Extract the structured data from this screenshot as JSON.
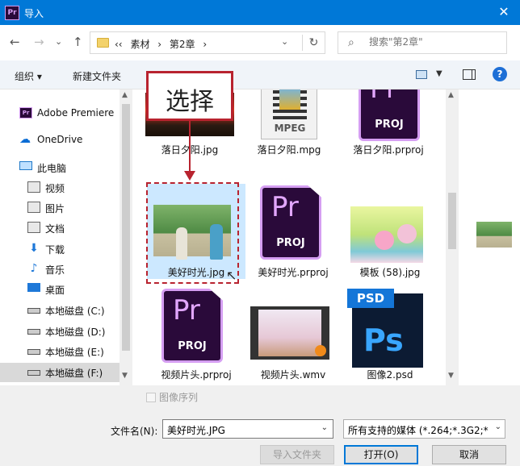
{
  "window": {
    "title": "导入",
    "app_icon_text": "Pr"
  },
  "nav": {
    "back": "←",
    "forward": "→",
    "recent": "⌄",
    "up": "↑",
    "breadcrumbs": [
      "‹‹",
      "素材",
      "›",
      "第2章",
      "›"
    ],
    "refresh": "↻",
    "search_placeholder": "搜索\"第2章\""
  },
  "toolbar": {
    "organize": "组织 ▾",
    "new_folder": "新建文件夹",
    "help": "?"
  },
  "sidebar": {
    "items": [
      {
        "label": "Adobe Premiere",
        "icon": "premiere-icon"
      },
      {
        "label": "OneDrive",
        "icon": "cloud-icon"
      },
      {
        "label": "此电脑",
        "icon": "pc-icon"
      },
      {
        "label": "视频",
        "icon": "video-icon"
      },
      {
        "label": "图片",
        "icon": "pictures-icon"
      },
      {
        "label": "文档",
        "icon": "documents-icon"
      },
      {
        "label": "下载",
        "icon": "download-icon"
      },
      {
        "label": "音乐",
        "icon": "music-icon"
      },
      {
        "label": "桌面",
        "icon": "desktop-icon"
      },
      {
        "label": "本地磁盘 (C:)",
        "icon": "drive-icon"
      },
      {
        "label": "本地磁盘 (D:)",
        "icon": "drive-icon"
      },
      {
        "label": "本地磁盘 (E:)",
        "icon": "drive-icon"
      },
      {
        "label": "本地磁盘 (F:)",
        "icon": "drive-icon"
      }
    ]
  },
  "files": [
    {
      "name": "落日夕阳.jpg",
      "kind": "image-sunset"
    },
    {
      "name": "落日夕阳.mpg",
      "kind": "mpeg",
      "badge": "MPEG"
    },
    {
      "name": "落日夕阳.prproj",
      "kind": "prproj"
    },
    {
      "name": "美好时光.jpg",
      "kind": "image-park",
      "selected": true
    },
    {
      "name": "美好时光.prproj",
      "kind": "prproj"
    },
    {
      "name": "模板 (58).jpg",
      "kind": "image-flowers"
    },
    {
      "name": "视频片头.prproj",
      "kind": "prproj"
    },
    {
      "name": "视频片头.wmv",
      "kind": "wmv"
    },
    {
      "name": "图像2.psd",
      "kind": "psd"
    }
  ],
  "pr_icon": {
    "glyph": "Pr",
    "label": "PROJ"
  },
  "psd_icon": {
    "tag": "PSD",
    "glyph": "Ps"
  },
  "annotation": {
    "label": "选择"
  },
  "footer": {
    "image_sequence": "图像序列",
    "filename_label": "文件名(N):",
    "filename_value": "美好时光.JPG",
    "filter_value": "所有支持的媒体 (*.264;*.3G2;*",
    "import_folder": "导入文件夹",
    "open": "打开(O)",
    "cancel": "取消"
  },
  "colors": {
    "titlebar": "#0078d7",
    "selection": "#cce8ff",
    "annotation": "#b8232f",
    "premiere_purple": "#2a0a3a"
  }
}
